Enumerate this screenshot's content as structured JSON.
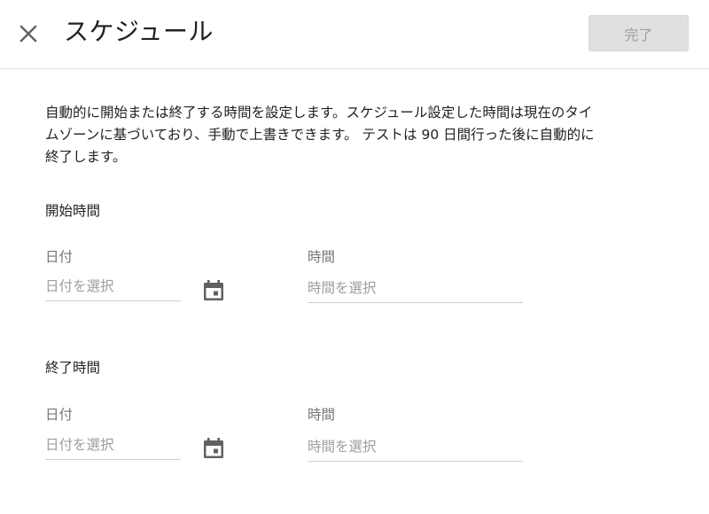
{
  "header": {
    "title": "スケジュール",
    "done_label": "完了"
  },
  "description": "自動的に開始または終了する時間を設定します。スケジュール設定した時間は現在のタイ\nムゾーンに基づいており、手動で上書きできます。 テストは 90 日間行った後に自動的に\n終了します。",
  "start": {
    "title": "開始時間",
    "date_label": "日付",
    "date_placeholder": "日付を選択",
    "time_label": "時間",
    "time_placeholder": "時間を選択"
  },
  "end": {
    "title": "終了時間",
    "date_label": "日付",
    "date_placeholder": "日付を選択",
    "time_label": "時間",
    "time_placeholder": "時間を選択"
  },
  "icons": {
    "close": "close-icon",
    "calendar": "calendar-icon"
  },
  "colors": {
    "title_text": "#212121",
    "secondary_text": "#757575",
    "placeholder_text": "#9e9e9e",
    "icon": "#616161",
    "done_button_bg": "#e0e0e0"
  }
}
